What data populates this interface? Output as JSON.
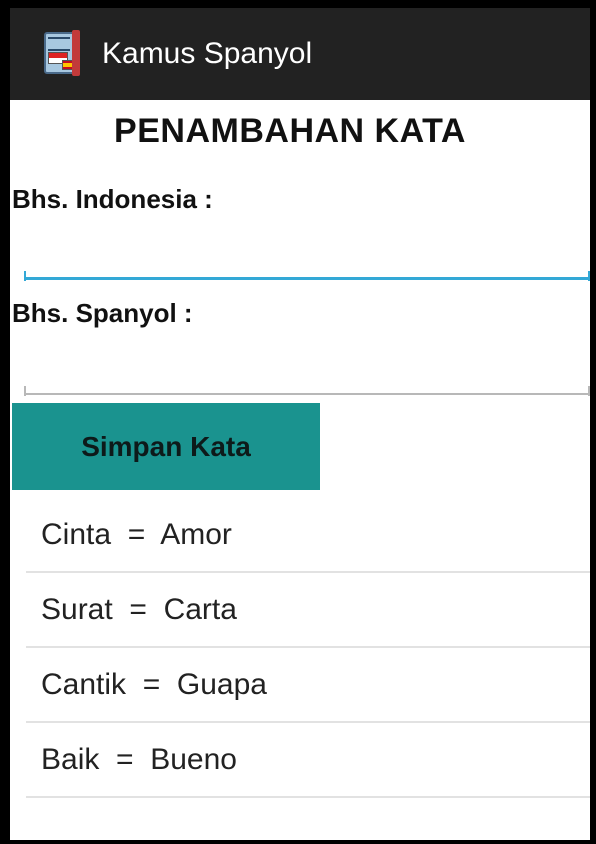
{
  "action_bar": {
    "title": "Kamus Spanyol",
    "icon": "dictionary-book-icon"
  },
  "form": {
    "heading": "PENAMBAHAN KATA",
    "indonesia_label": "Bhs. Indonesia :",
    "indonesia_value": "",
    "spanyol_label": "Bhs. Spanyol :",
    "spanyol_value": "",
    "save_label": "Simpan Kata"
  },
  "words": [
    {
      "text": "Cinta  =  Amor"
    },
    {
      "text": "Surat  =  Carta"
    },
    {
      "text": "Cantik  =  Guapa"
    },
    {
      "text": "Baik  =  Bueno"
    }
  ],
  "colors": {
    "action_bar": "#222222",
    "button": "#1a938f",
    "focused_underline": "#33a8d6"
  }
}
